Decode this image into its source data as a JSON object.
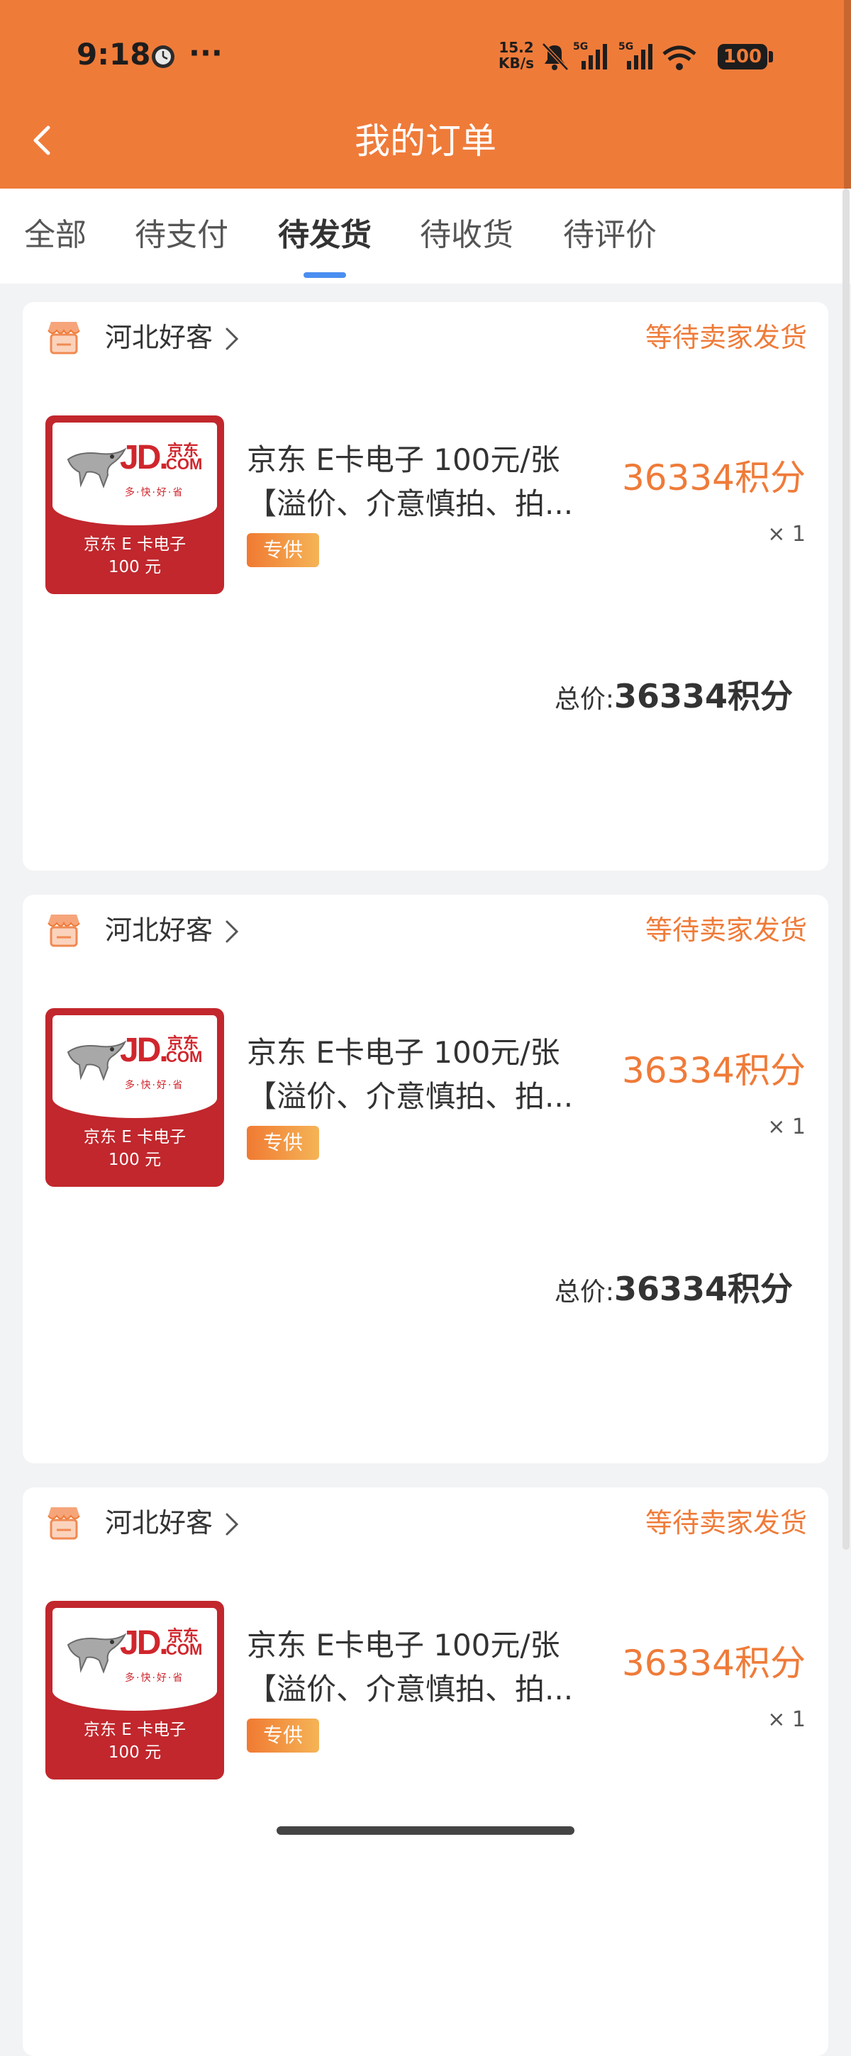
{
  "status_bar": {
    "time": "9:18",
    "more": "···",
    "net_speed_value": "15.2",
    "net_speed_unit": "KB/s",
    "signal_1_label": "5G",
    "signal_2_label": "5G",
    "battery": "100"
  },
  "header": {
    "title": "我的订单",
    "back_icon": "chevron-left-icon"
  },
  "tabs": [
    {
      "label": "全部",
      "active": false
    },
    {
      "label": "待支付",
      "active": false
    },
    {
      "label": "待发货",
      "active": true
    },
    {
      "label": "待收货",
      "active": false
    },
    {
      "label": "待评价",
      "active": false
    }
  ],
  "orders": [
    {
      "store_name": "河北好客",
      "status": "等待卖家发货",
      "image_caption_line1": "京东 E 卡电子",
      "image_caption_line2": "100 元",
      "title_line1": "京东 E卡电子 100元/张",
      "title_line2": "【溢价、介意慎拍、拍...",
      "badge": "专供",
      "price": "36334积分",
      "quantity": "× 1",
      "total_label": "总价:",
      "total_value": "36334积分"
    },
    {
      "store_name": "河北好客",
      "status": "等待卖家发货",
      "image_caption_line1": "京东 E 卡电子",
      "image_caption_line2": "100 元",
      "title_line1": "京东 E卡电子 100元/张",
      "title_line2": "【溢价、介意慎拍、拍...",
      "badge": "专供",
      "price": "36334积分",
      "quantity": "× 1",
      "total_label": "总价:",
      "total_value": "36334积分"
    },
    {
      "store_name": "河北好客",
      "status": "等待卖家发货",
      "image_caption_line1": "京东 E 卡电子",
      "image_caption_line2": "100 元",
      "title_line1": "京东 E卡电子 100元/张",
      "title_line2": "【溢价、介意慎拍、拍...",
      "badge": "专供",
      "price": "36334积分",
      "quantity": "× 1",
      "total_label": "",
      "total_value": ""
    }
  ],
  "logo_text": {
    "jd": "JD.",
    "cn": "京东",
    "com": "COM",
    "slogan": "多·快·好·省"
  },
  "colors": {
    "header_bg": "#ef7b39",
    "accent_orange": "#ef7b39",
    "tab_indicator": "#4a8ef0",
    "jd_red": "#c1272d"
  }
}
